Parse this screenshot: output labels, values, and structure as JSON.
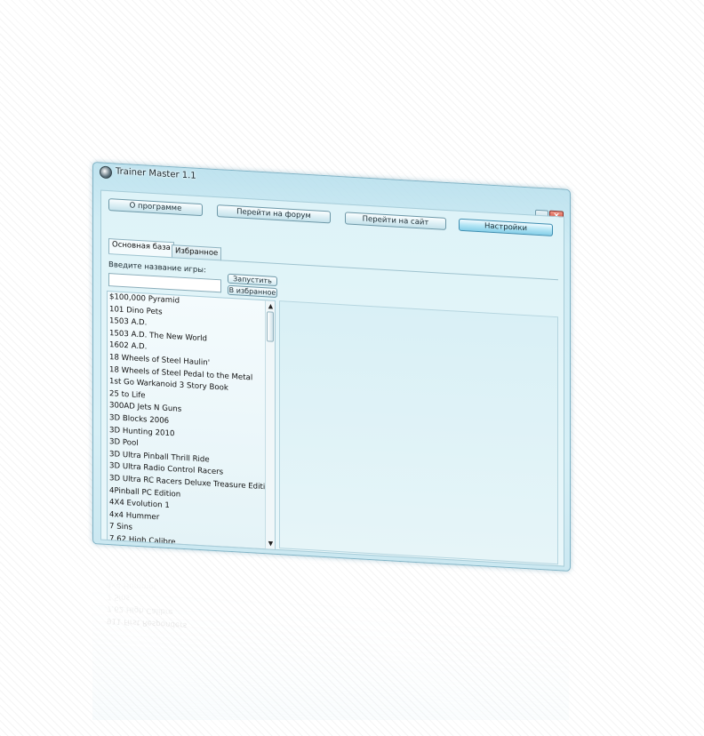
{
  "window": {
    "title": "Trainer Master 1.1"
  },
  "toolbar": {
    "about_label": "О программе",
    "forum_label": "Перейти на форум",
    "site_label": "Перейти на сайт",
    "settings_label": "Настройки"
  },
  "tabs": {
    "main_label": "Основная база",
    "favorites_label": "Избранное"
  },
  "search": {
    "label": "Введите название игры:",
    "value": "",
    "placeholder": "",
    "run_label": "Запустить",
    "add_fav_label": "В избранное"
  },
  "games": [
    "$100,000 Pyramid",
    "101 Dino Pets",
    "1503 A.D.",
    "1503 A.D. The New World",
    "1602 A.D.",
    "18 Wheels of Steel Haulin'",
    "18 Wheels of Steel Pedal to the Metal",
    "1st Go Warkanoid 3 Story Book",
    "25 to Life",
    "300AD Jets N Guns",
    "3D Blocks 2006",
    "3D Hunting 2010",
    "3D Pool",
    "3D Ultra Pinball Thrill Ride",
    "3D Ultra Radio Control Racers",
    "3D Ultra RC Racers Deluxe Treasure Edition",
    "4Pinball PC Edition",
    "4X4 Evolution 1",
    "4x4 Hummer",
    "7 Sins",
    "7.62 High Calibre",
    "911 First Responders"
  ],
  "reflection_items": [
    "911 First Responders",
    "7.62 High Calibre",
    "7 Sins",
    "4x4 Hummer",
    "4X4 Evolution 1"
  ]
}
